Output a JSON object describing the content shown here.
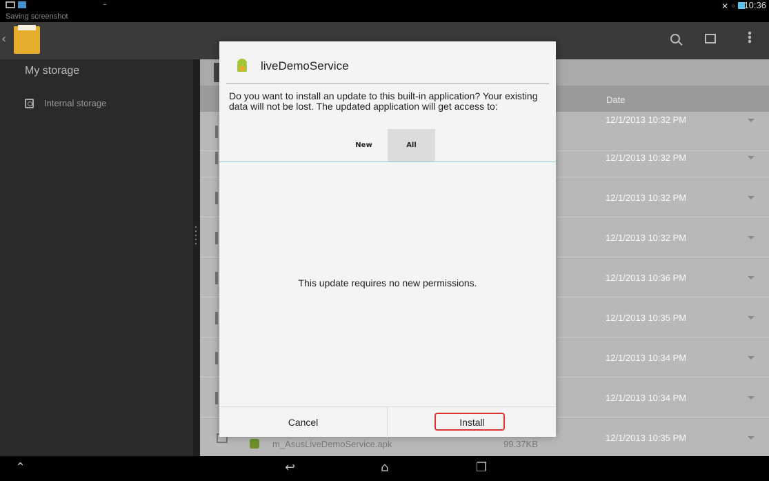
{
  "status_bar": {
    "notification_text": "Saving screenshot",
    "time": "10:36",
    "icons": [
      "image-icon",
      "gallery-icon",
      "no-signal-icon",
      "wifi-icon",
      "battery-icon"
    ]
  },
  "action_bar": {
    "icons": [
      "back-icon",
      "folder-icon",
      "search-icon",
      "new-window-icon",
      "overflow-menu-icon"
    ]
  },
  "sidebar": {
    "title": "My storage",
    "items": [
      {
        "label": "Internal storage",
        "icon": "storage-icon"
      }
    ]
  },
  "file_list": {
    "columns": {
      "date": "Date"
    },
    "rows": [
      {
        "date": "12/1/2013 10:32 PM"
      },
      {
        "date": "12/1/2013 10:32 PM"
      },
      {
        "date": "12/1/2013 10:32 PM"
      },
      {
        "date": "12/1/2013 10:32 PM"
      },
      {
        "date": "12/1/2013 10:36 PM"
      },
      {
        "date": "12/1/2013 10:35 PM"
      },
      {
        "date": "12/1/2013 10:34 PM"
      },
      {
        "date": "12/1/2013 10:34 PM"
      },
      {
        "date": "12/1/2013 10:35 PM",
        "name": "m_AsusLiveDemoService.apk",
        "size": "99.37KB"
      }
    ]
  },
  "dialog": {
    "title": "liveDemoService",
    "message": "Do you want to install an update to this built-in application? Your existing data will not be lost. The updated application will get access to:",
    "tabs": {
      "new": "New",
      "all": "All",
      "selected": "All"
    },
    "permissions_message": "This update requires no new permissions.",
    "cancel_label": "Cancel",
    "install_label": "Install",
    "highlight_color": "#e0322e"
  },
  "nav_bar": {
    "icons": [
      "menu-up-icon",
      "back-icon",
      "home-icon",
      "recent-apps-icon"
    ]
  }
}
